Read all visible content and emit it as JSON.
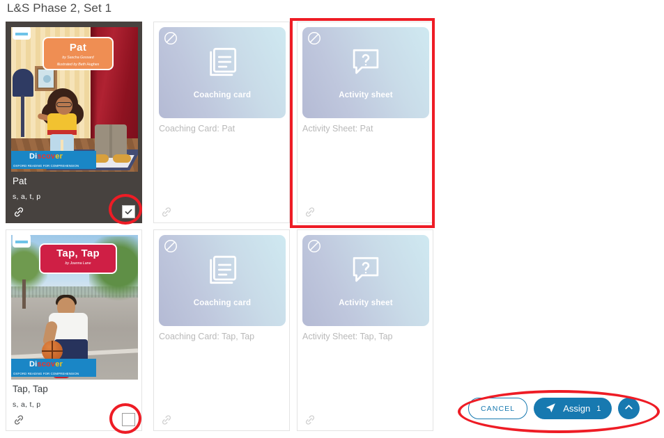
{
  "page": {
    "title": "L&S Phase 2, Set 1"
  },
  "colors": {
    "accent_blue": "#1779b0",
    "selected_card_bg": "#47423f",
    "annotation_red": "#ee1c25",
    "muted_text": "#b9b9b9"
  },
  "rows": [
    {
      "book": {
        "cover_title": "Pat",
        "cover_author": "by Sascha Gossard",
        "cover_illustrator": "illustrated by Beth Hughes",
        "logo_word_1": "Di",
        "logo_word_2": "scov",
        "logo_word_3": "er",
        "logo_sub": "OXFORD READING FOR COMPREHENSION",
        "name": "Pat",
        "sounds": "s, a, t, p",
        "link_icon": "link-icon",
        "checkbox_state": "checked"
      },
      "coaching": {
        "badge_icon": "prohibited-icon",
        "glyph_icon": "pages-icon",
        "thumb_label": "Coaching card",
        "name": "Coaching Card: Pat",
        "link_icon": "link-icon"
      },
      "activity": {
        "badge_icon": "prohibited-icon",
        "glyph_icon": "question-bubble-icon",
        "thumb_label": "Activity sheet",
        "name": "Activity Sheet: Pat",
        "link_icon": "link-icon"
      }
    },
    {
      "book": {
        "cover_title": "Tap, Tap",
        "cover_author": "by Joanna Lane",
        "cover_illustrator": "",
        "logo_word_1": "Di",
        "logo_word_2": "scov",
        "logo_word_3": "er",
        "logo_sub": "OXFORD READING FOR COMPREHENSION",
        "name": "Tap, Tap",
        "sounds": "s, a, t, p",
        "link_icon": "link-icon",
        "checkbox_state": "unchecked"
      },
      "coaching": {
        "badge_icon": "prohibited-icon",
        "glyph_icon": "pages-icon",
        "thumb_label": "Coaching card",
        "name": "Coaching Card: Tap, Tap",
        "link_icon": "link-icon"
      },
      "activity": {
        "badge_icon": "prohibited-icon",
        "glyph_icon": "question-bubble-icon",
        "thumb_label": "Activity sheet",
        "name": "Activity Sheet: Tap, Tap",
        "link_icon": "link-icon"
      }
    }
  ],
  "actions": {
    "cancel_label": "CANCEL",
    "assign_label": "Assign",
    "assign_count": "1",
    "assign_icon": "paper-plane-icon",
    "scroll_up_icon": "chevron-up-icon"
  },
  "annotations": [
    {
      "shape": "rectangle",
      "target": "activity-sheet-pat-card"
    },
    {
      "shape": "ellipse",
      "target": "pat-checkbox"
    },
    {
      "shape": "ellipse",
      "target": "tap-tap-checkbox"
    },
    {
      "shape": "ellipse",
      "target": "action-buttons"
    }
  ]
}
